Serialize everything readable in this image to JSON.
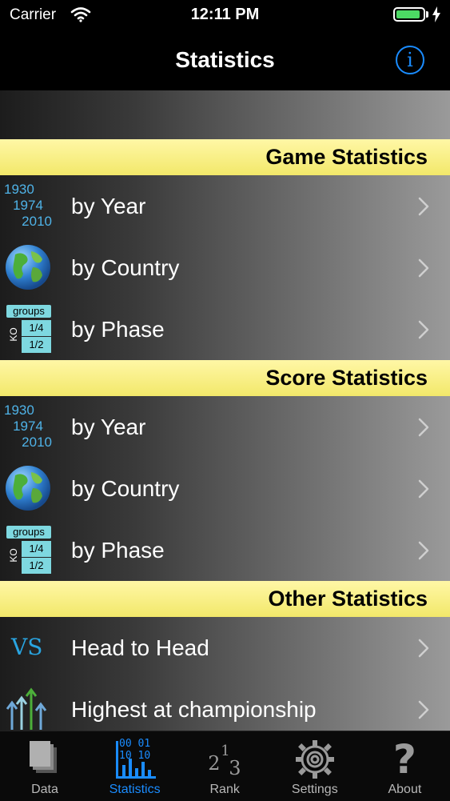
{
  "status": {
    "carrier": "Carrier",
    "time": "12:11 PM",
    "battery_level": 0.9
  },
  "nav": {
    "title": "Statistics",
    "info_glyph": "i",
    "info_icon": "info-circle-icon"
  },
  "sections": [
    {
      "title": "Game Statistics",
      "rows": [
        {
          "label": "by Year",
          "icon": "years-icon",
          "years": [
            "1930",
            "1974",
            "2010"
          ]
        },
        {
          "label": "by Country",
          "icon": "globe-icon"
        },
        {
          "label": "by Phase",
          "icon": "phase-icon",
          "phase": {
            "groups": "groups",
            "ko": "KO",
            "q1": "1/4",
            "q2": "1/2"
          }
        }
      ]
    },
    {
      "title": "Score Statistics",
      "rows": [
        {
          "label": "by Year",
          "icon": "years-icon",
          "years": [
            "1930",
            "1974",
            "2010"
          ]
        },
        {
          "label": "by Country",
          "icon": "globe-icon"
        },
        {
          "label": "by Phase",
          "icon": "phase-icon",
          "phase": {
            "groups": "groups",
            "ko": "KO",
            "q1": "1/4",
            "q2": "1/2"
          }
        }
      ]
    },
    {
      "title": "Other Statistics",
      "rows": [
        {
          "label": "Head to Head",
          "icon": "vs-icon",
          "vs": "VS"
        },
        {
          "label": "Highest at championship",
          "icon": "arrows-up-icon"
        }
      ]
    }
  ],
  "tabs": [
    {
      "label": "Data",
      "icon": "data-icon",
      "active": false
    },
    {
      "label": "Statistics",
      "icon": "statistics-icon",
      "active": true,
      "digits": [
        "00",
        "01",
        "10",
        "10"
      ]
    },
    {
      "label": "Rank",
      "icon": "rank-icon",
      "active": false,
      "digits": [
        "2",
        "1",
        "3"
      ]
    },
    {
      "label": "Settings",
      "icon": "gear-icon",
      "active": false
    },
    {
      "label": "About",
      "icon": "question-icon",
      "active": false,
      "glyph": "?"
    }
  ],
  "colors": {
    "accent": "#1a8cff",
    "header_yellow": "#f2e86a",
    "icon_cyan": "#7ed8e0",
    "year_blue": "#4fb3e8"
  }
}
